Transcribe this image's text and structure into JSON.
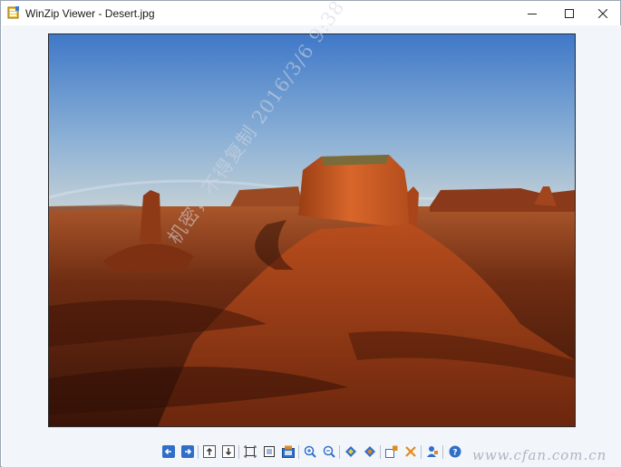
{
  "window": {
    "title": "WinZip Viewer - Desert.jpg",
    "icons": {
      "app": "winzip-icon",
      "minimize": "minimize-icon",
      "maximize": "maximize-icon",
      "close": "close-icon"
    }
  },
  "image": {
    "file_name": "Desert.jpg",
    "watermark": "机密，不得复制 2016/3/6 9:38"
  },
  "toolbar": {
    "buttons": [
      {
        "icon": "previous-arrow-icon"
      },
      {
        "icon": "next-arrow-icon"
      },
      {
        "icon": "first-image-icon"
      },
      {
        "icon": "last-image-icon"
      },
      {
        "icon": "fit-to-window-icon"
      },
      {
        "icon": "actual-size-icon"
      },
      {
        "icon": "fullscreen-icon"
      },
      {
        "icon": "zoom-in-icon"
      },
      {
        "icon": "zoom-out-icon"
      },
      {
        "icon": "rotate-left-icon"
      },
      {
        "icon": "rotate-right-icon"
      },
      {
        "icon": "extract-icon"
      },
      {
        "icon": "delete-icon"
      },
      {
        "icon": "share-icon"
      },
      {
        "icon": "help-icon"
      }
    ]
  },
  "overlay": {
    "site_watermark": "www.cfan.com.cn"
  },
  "colors": {
    "accent": "#2f6fc9",
    "toolbar_bg": "#f2f5fa",
    "delete": "#e08a1e"
  }
}
